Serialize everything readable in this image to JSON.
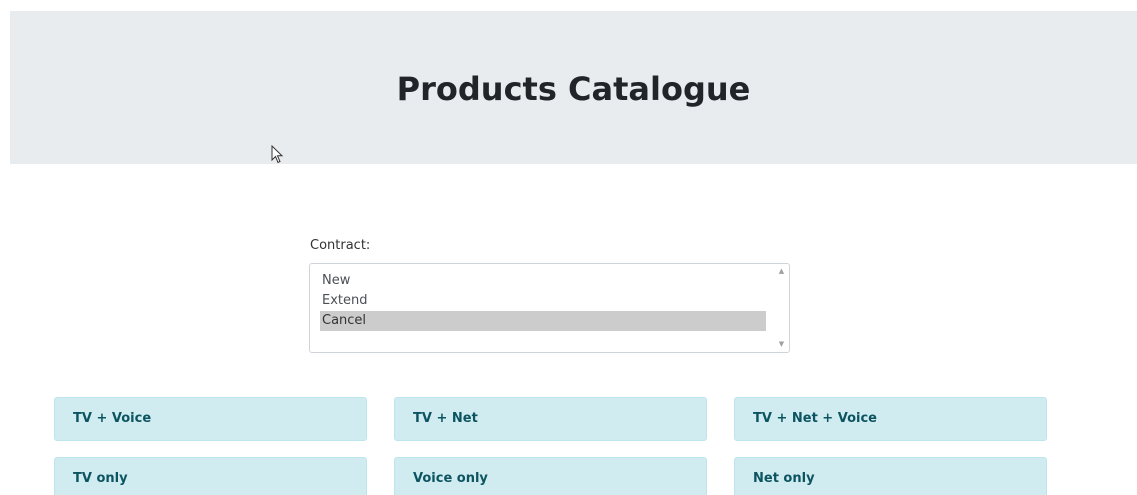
{
  "header": {
    "title": "Products Catalogue"
  },
  "contract": {
    "label": "Contract:",
    "options": [
      "New",
      "Extend",
      "Cancel"
    ],
    "selected": "Cancel"
  },
  "products": [
    "TV + Voice",
    "TV + Net",
    "TV + Net + Voice",
    "TV only",
    "Voice only",
    "Net only"
  ],
  "colors": {
    "hero_background": "#e9ecef",
    "card_background": "#d1ecf1",
    "card_text": "#0c5460",
    "selected_option": "#cccccc"
  }
}
